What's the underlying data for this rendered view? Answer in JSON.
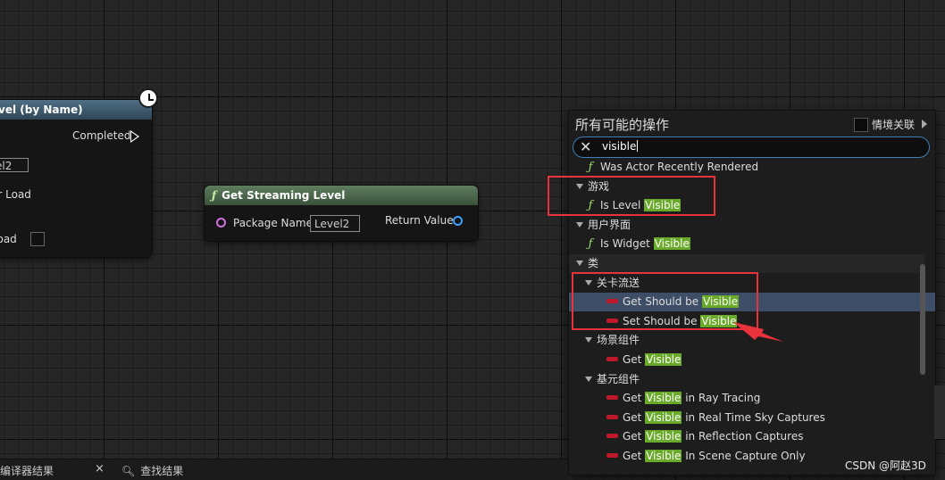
{
  "node1": {
    "title": "vel (by Name)",
    "completed": "Completed",
    "level_value": "el2",
    "after_load": "er Load",
    "load": "Load"
  },
  "node2": {
    "title": "Get Streaming Level",
    "package_name": "Package Name",
    "package_value": "Level2",
    "return_value": "Return Value"
  },
  "palette": {
    "title": "所有可能的操作",
    "context_label": "情境关联",
    "search_value": "visible",
    "items": [
      {
        "kind": "function",
        "indent": 2,
        "pre": "Was Actor Recently Rendered",
        "hl": "",
        "post": ""
      },
      {
        "kind": "category",
        "indent": 1,
        "label": "游戏"
      },
      {
        "kind": "function",
        "indent": 2,
        "pre": "Is Level ",
        "hl": "Visible",
        "post": ""
      },
      {
        "kind": "category",
        "indent": 1,
        "label": "用户界面"
      },
      {
        "kind": "function",
        "indent": 2,
        "pre": "Is Widget ",
        "hl": "Visible",
        "post": ""
      },
      {
        "kind": "category",
        "indent": 1,
        "label": "类",
        "bg": true
      },
      {
        "kind": "category",
        "indent": 2,
        "label": "关卡流送"
      },
      {
        "kind": "variable",
        "indent": 3,
        "pre": "Get Should be ",
        "hl": "Visible",
        "post": "",
        "selected": true
      },
      {
        "kind": "variable",
        "indent": 3,
        "pre": "Set Should be ",
        "hl": "Visible",
        "post": ""
      },
      {
        "kind": "category",
        "indent": 2,
        "label": "场景组件"
      },
      {
        "kind": "variable",
        "indent": 3,
        "pre": "Get ",
        "hl": "Visible",
        "post": ""
      },
      {
        "kind": "category",
        "indent": 2,
        "label": "基元组件"
      },
      {
        "kind": "variable",
        "indent": 3,
        "pre": "Get ",
        "hl": "Visible",
        "post": " in Ray Tracing"
      },
      {
        "kind": "variable",
        "indent": 3,
        "pre": "Get ",
        "hl": "Visible",
        "post": " in Real Time Sky Captures"
      },
      {
        "kind": "variable",
        "indent": 3,
        "pre": "Get ",
        "hl": "Visible",
        "post": " in Reflection Captures"
      },
      {
        "kind": "variable",
        "indent": 3,
        "pre": "Get ",
        "hl": "Visible",
        "post": " In Scene Capture Only"
      }
    ]
  },
  "tabs": {
    "compiler_results": "编译器结果",
    "close_symbol": "×",
    "find_results": "查找结果"
  },
  "watermark": "CSDN @阿赵3D",
  "colors": {
    "highlight": "#6aaa2a",
    "selection": "#3e4e66",
    "annotation_red": "#e8323c",
    "function_icon": "#9fdf6f",
    "variable_icon": "#c0182a"
  }
}
